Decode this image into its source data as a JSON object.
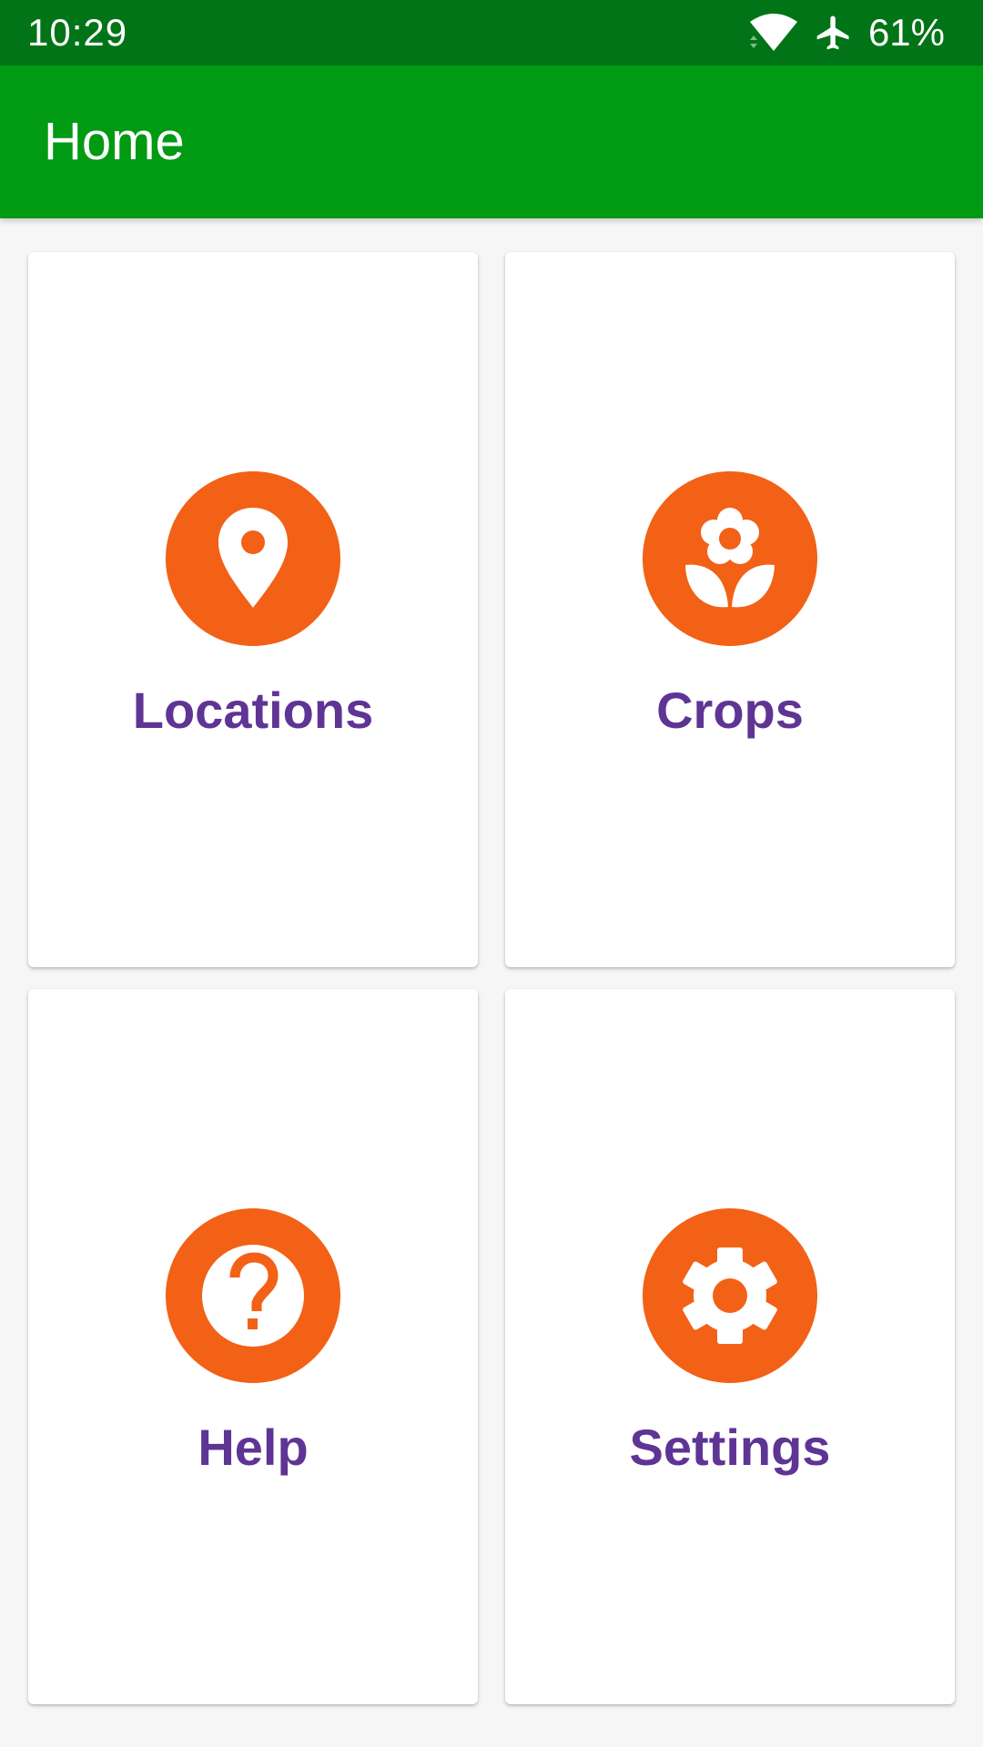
{
  "status_bar": {
    "time": "10:29",
    "battery": "61%",
    "icons": [
      "wifi-icon",
      "airplane-mode-icon"
    ]
  },
  "app_bar": {
    "title": "Home"
  },
  "colors": {
    "status_bar": "#007417",
    "app_bar": "#009a13",
    "icon_circle": "#f26116",
    "label": "#5e3494",
    "background": "#f6f6f6"
  },
  "tiles": [
    {
      "label": "Locations",
      "icon": "location-pin-icon"
    },
    {
      "label": "Crops",
      "icon": "flower-icon"
    },
    {
      "label": "Help",
      "icon": "help-icon"
    },
    {
      "label": "Settings",
      "icon": "gear-icon"
    }
  ]
}
